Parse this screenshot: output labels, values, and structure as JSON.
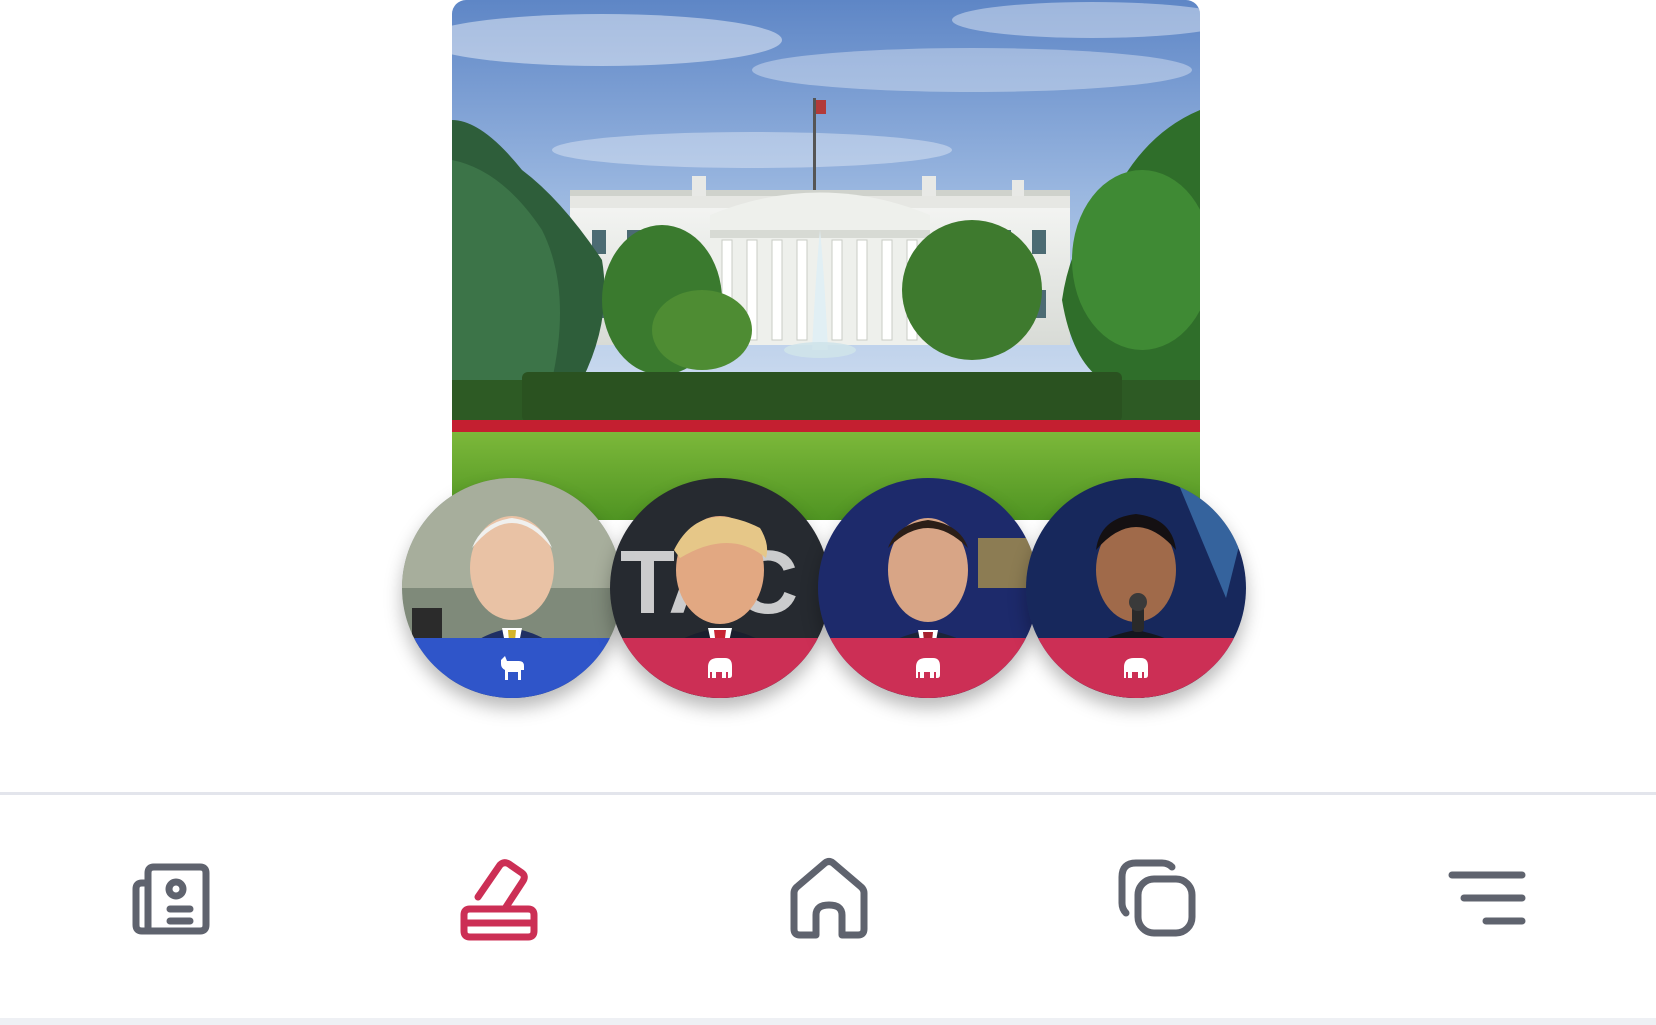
{
  "hero": {
    "image": "white-house-photo",
    "alt": "White House"
  },
  "candidates": [
    {
      "id": "candidate-1",
      "party": "democrat",
      "party_icon": "donkey-icon",
      "band_color": "#2f55c9"
    },
    {
      "id": "candidate-2",
      "party": "republican",
      "party_icon": "elephant-icon",
      "band_color": "#cc2f55"
    },
    {
      "id": "candidate-3",
      "party": "republican",
      "party_icon": "elephant-icon",
      "band_color": "#cc2f55"
    },
    {
      "id": "candidate-4",
      "party": "republican",
      "party_icon": "elephant-icon",
      "band_color": "#cc2f55"
    }
  ],
  "bottom_nav": {
    "items": [
      {
        "icon": "news-icon",
        "active": false
      },
      {
        "icon": "ballot-box-icon",
        "active": true
      },
      {
        "icon": "home-icon",
        "active": false
      },
      {
        "icon": "copy-icon",
        "active": false
      },
      {
        "icon": "menu-icon",
        "active": false
      }
    ],
    "active_color": "#cc2f55",
    "inactive_color": "#5f636e"
  }
}
